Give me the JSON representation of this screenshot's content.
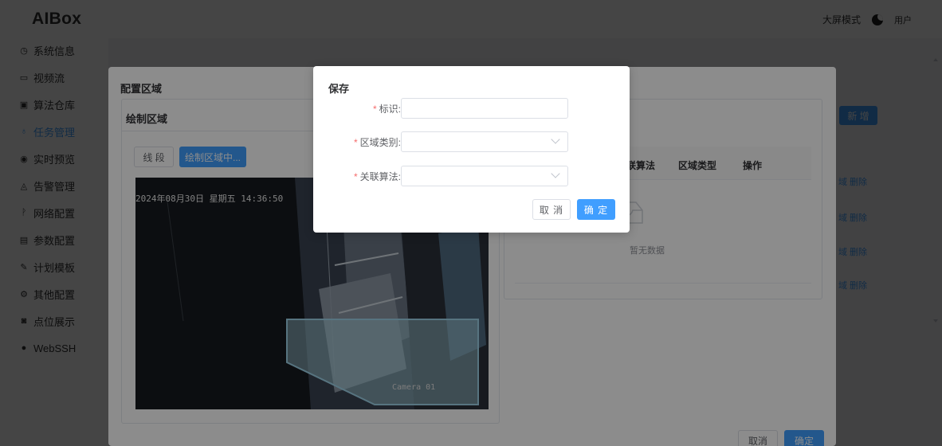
{
  "app": {
    "logo": "AIBox",
    "bigscreen_mode": "大屏模式",
    "user": "用户"
  },
  "sidebar": {
    "items": [
      {
        "label": "系统信息",
        "icon": "clock-icon"
      },
      {
        "label": "视频流",
        "icon": "video-icon"
      },
      {
        "label": "算法仓库",
        "icon": "storage-icon"
      },
      {
        "label": "任务管理",
        "icon": "task-icon",
        "active": true
      },
      {
        "label": "实时预览",
        "icon": "preview-icon"
      },
      {
        "label": "告警管理",
        "icon": "alarm-icon"
      },
      {
        "label": "网络配置",
        "icon": "network-icon"
      },
      {
        "label": "参数配置",
        "icon": "params-icon"
      },
      {
        "label": "计划模板",
        "icon": "plan-icon"
      },
      {
        "label": "其他配置",
        "icon": "settings-icon"
      },
      {
        "label": "点位展示",
        "icon": "camera-icon"
      },
      {
        "label": "WebSSH",
        "icon": "globe-icon"
      }
    ]
  },
  "background": {
    "add_button": "新 增",
    "row_links": [
      "域 删除",
      "域 删除",
      "域 删除",
      "域 删除"
    ]
  },
  "config_dialog": {
    "title": "配置区域",
    "draw_card_title": "绘制区域",
    "segment_button": "线 段",
    "drawing_button": "绘制区域中...",
    "camera_timestamp": "2024年08月30日 星期五 14:36:50",
    "camera_name": "Camera 01",
    "table_headers": [
      "联算法",
      "区域类型",
      "操作"
    ],
    "empty_text": "暂无数据",
    "cancel": "取消",
    "confirm": "确定"
  },
  "save_dialog": {
    "title": "保存",
    "fields": [
      {
        "label": "标识:",
        "value": "",
        "type": "input"
      },
      {
        "label": "区域类别:",
        "value": "",
        "type": "select"
      },
      {
        "label": "关联算法:",
        "value": "",
        "type": "select"
      }
    ],
    "cancel": "取 消",
    "confirm": "确 定"
  },
  "colors": {
    "primary": "#409eff",
    "required": "#f56c6c",
    "mask": "rgba(0,0,0,0.5)"
  }
}
